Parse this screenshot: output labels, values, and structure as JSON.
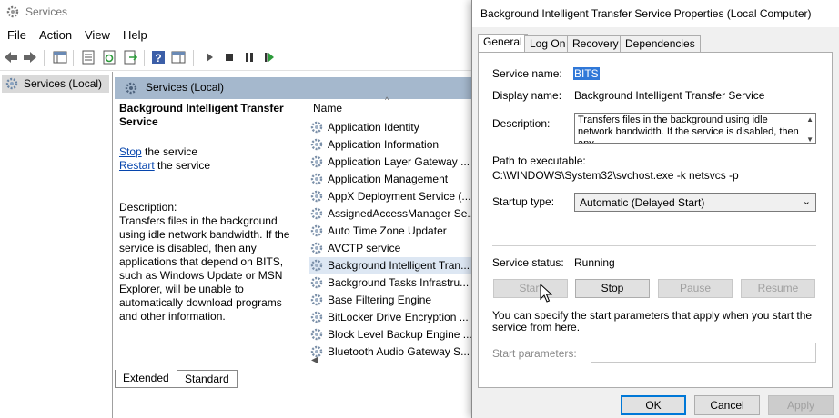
{
  "services_window": {
    "title": "Services",
    "menu": [
      "File",
      "Action",
      "View",
      "Help"
    ],
    "tree_node": "Services (Local)",
    "pane_header": "Services (Local)",
    "desc_title": "Background Intelligent Transfer Service",
    "stop_link": "Stop",
    "stop_suffix": " the service",
    "restart_link": "Restart",
    "restart_suffix": " the service",
    "description_label": "Description:",
    "description_text": "Transfers files in the background using idle network bandwidth. If the service is disabled, then any applications that depend on BITS, such as Windows Update or MSN Explorer, will be unable to automatically download programs and other information.",
    "column_name": "Name",
    "services": [
      "Application Identity",
      "Application Information",
      "Application Layer Gateway ...",
      "Application Management",
      "AppX Deployment Service (...",
      "AssignedAccessManager Se...",
      "Auto Time Zone Updater",
      "AVCTP service",
      "Background Intelligent Tran...",
      "Background Tasks Infrastru...",
      "Base Filtering Engine",
      "BitLocker Drive Encryption ...",
      "Block Level Backup Engine ...",
      "Bluetooth Audio Gateway S..."
    ],
    "selected_index": 8,
    "bottom_tabs": [
      "Extended",
      "Standard"
    ]
  },
  "dialog": {
    "title": "Background Intelligent Transfer Service Properties (Local Computer)",
    "tabs": [
      "General",
      "Log On",
      "Recovery",
      "Dependencies"
    ],
    "service_name_label": "Service name:",
    "service_name_value": "BITS",
    "display_name_label": "Display name:",
    "display_name_value": "Background Intelligent Transfer Service",
    "description_label": "Description:",
    "description_value": "Transfers files in the background using idle network bandwidth. If the service is disabled, then any",
    "path_label": "Path to executable:",
    "path_value": "C:\\WINDOWS\\System32\\svchost.exe -k netsvcs -p",
    "startup_label": "Startup type:",
    "startup_value": "Automatic (Delayed Start)",
    "status_label": "Service status:",
    "status_value": "Running",
    "buttons": {
      "start": "Start",
      "stop": "Stop",
      "pause": "Pause",
      "resume": "Resume"
    },
    "hint": "You can specify the start parameters that apply when you start the service from here.",
    "params_label": "Start parameters:",
    "footer": {
      "ok": "OK",
      "cancel": "Cancel",
      "apply": "Apply"
    }
  }
}
